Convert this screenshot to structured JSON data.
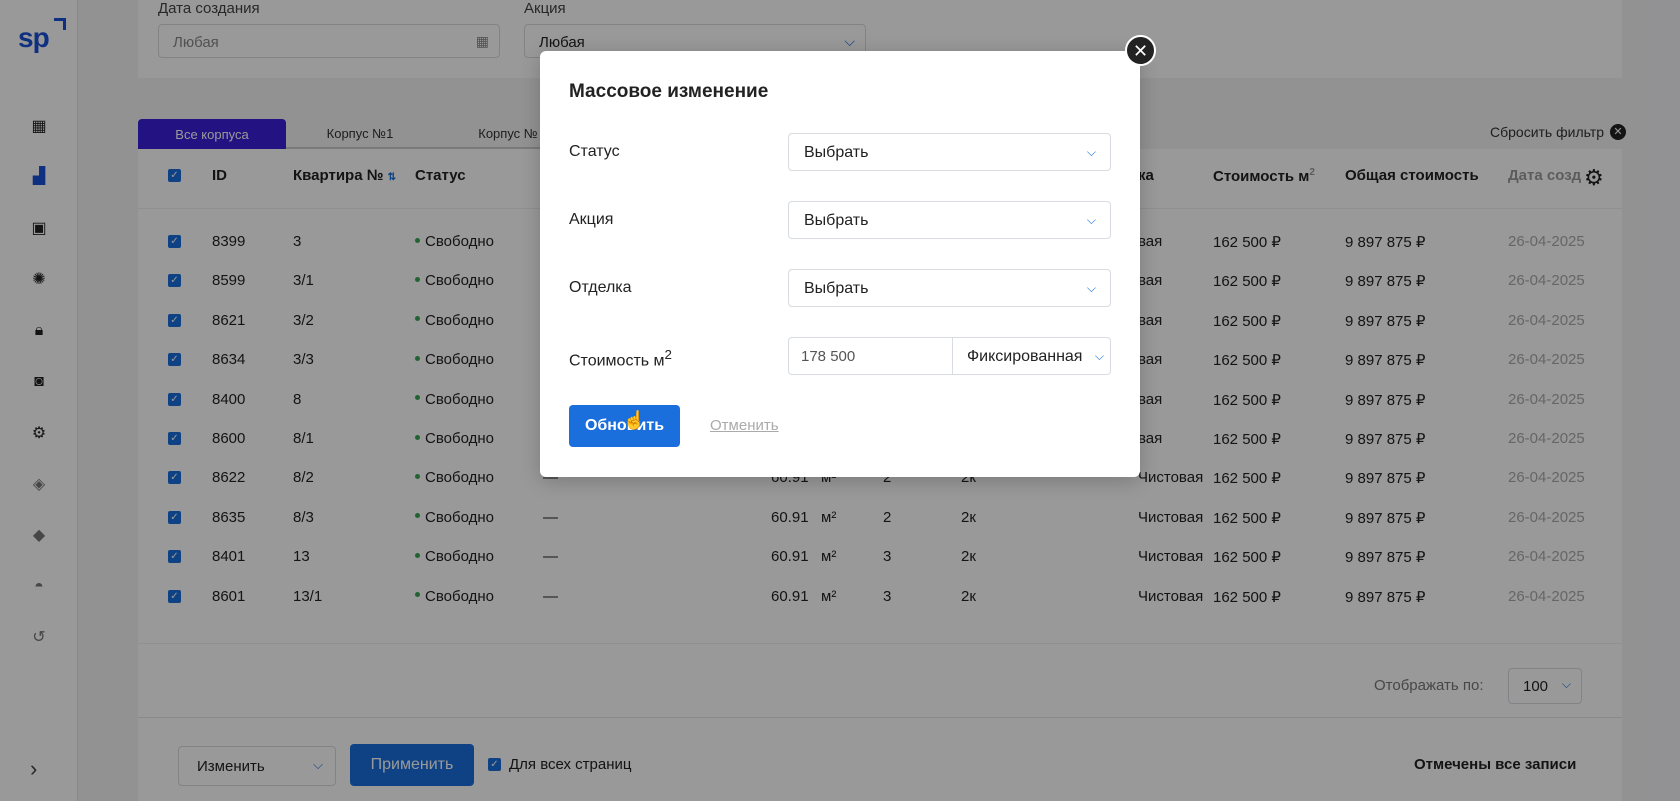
{
  "sidebar": {
    "logo": "sp",
    "icons": [
      "dashboard-icon",
      "buildings-icon",
      "floorplan-icon",
      "palette-icon",
      "lock-icon",
      "bag-icon",
      "settings-icon",
      "diamond-icon",
      "tag-icon",
      "helmet-icon",
      "history-icon"
    ],
    "expand_glyph": "›"
  },
  "filters": {
    "created_label": "Дата создания",
    "created_value": "Любая",
    "promo_label": "Акция",
    "promo_value": "Любая"
  },
  "tabs": [
    "Все корпуса",
    "Корпус №1",
    "Корпус №"
  ],
  "reset_filter": "Сбросить фильтр",
  "table": {
    "headers": {
      "id": "ID",
      "apt": "Квартира №",
      "status": "Статус",
      "finish": "ка",
      "price_m2": "Стоимость м",
      "total": "Общая стоимость",
      "date": "Дата созд"
    },
    "rows": [
      {
        "id": "8399",
        "apt": "3",
        "status": "Свободно",
        "dash": "",
        "area": "",
        "unit": "",
        "rooms": "",
        "type": "",
        "finish": "вая",
        "price": "162 500 ₽",
        "total": "9 897 875 ₽",
        "date": "26-04-2025"
      },
      {
        "id": "8599",
        "apt": "3/1",
        "status": "Свободно",
        "dash": "",
        "area": "",
        "unit": "",
        "rooms": "",
        "type": "",
        "finish": "вая",
        "price": "162 500 ₽",
        "total": "9 897 875 ₽",
        "date": "26-04-2025"
      },
      {
        "id": "8621",
        "apt": "3/2",
        "status": "Свободно",
        "dash": "",
        "area": "",
        "unit": "",
        "rooms": "",
        "type": "",
        "finish": "вая",
        "price": "162 500 ₽",
        "total": "9 897 875 ₽",
        "date": "26-04-2025"
      },
      {
        "id": "8634",
        "apt": "3/3",
        "status": "Свободно",
        "dash": "",
        "area": "",
        "unit": "",
        "rooms": "",
        "type": "",
        "finish": "вая",
        "price": "162 500 ₽",
        "total": "9 897 875 ₽",
        "date": "26-04-2025"
      },
      {
        "id": "8400",
        "apt": "8",
        "status": "Свободно",
        "dash": "",
        "area": "",
        "unit": "",
        "rooms": "",
        "type": "",
        "finish": "вая",
        "price": "162 500 ₽",
        "total": "9 897 875 ₽",
        "date": "26-04-2025"
      },
      {
        "id": "8600",
        "apt": "8/1",
        "status": "Свободно",
        "dash": "",
        "area": "",
        "unit": "",
        "rooms": "",
        "type": "",
        "finish": "вая",
        "price": "162 500 ₽",
        "total": "9 897 875 ₽",
        "date": "26-04-2025"
      },
      {
        "id": "8622",
        "apt": "8/2",
        "status": "Свободно",
        "dash": "—",
        "area": "60.91",
        "unit": "м²",
        "rooms": "2",
        "type": "2к",
        "finish": "Чистовая",
        "price": "162 500 ₽",
        "total": "9 897 875 ₽",
        "date": "26-04-2025"
      },
      {
        "id": "8635",
        "apt": "8/3",
        "status": "Свободно",
        "dash": "—",
        "area": "60.91",
        "unit": "м²",
        "rooms": "2",
        "type": "2к",
        "finish": "Чистовая",
        "price": "162 500 ₽",
        "total": "9 897 875 ₽",
        "date": "26-04-2025"
      },
      {
        "id": "8401",
        "apt": "13",
        "status": "Свободно",
        "dash": "—",
        "area": "60.91",
        "unit": "м²",
        "rooms": "3",
        "type": "2к",
        "finish": "Чистовая",
        "price": "162 500 ₽",
        "total": "9 897 875 ₽",
        "date": "26-04-2025"
      },
      {
        "id": "8601",
        "apt": "13/1",
        "status": "Свободно",
        "dash": "—",
        "area": "60.91",
        "unit": "м²",
        "rooms": "3",
        "type": "2к",
        "finish": "Чистовая",
        "price": "162 500 ₽",
        "total": "9 897 875 ₽",
        "date": "26-04-2025"
      }
    ]
  },
  "pager": {
    "label": "Отображать по:",
    "value": "100"
  },
  "bottom": {
    "action_select": "Изменить",
    "apply": "Применить",
    "all_pages": "Для всех страниц",
    "all_selected": "Отмечены все записи"
  },
  "modal": {
    "title": "Массовое изменение",
    "status_label": "Статус",
    "status_value": "Выбрать",
    "promo_label": "Акция",
    "promo_value": "Выбрать",
    "finish_label": "Отделка",
    "finish_value": "Выбрать",
    "price_label": "Стоимость м",
    "price_sup": "2",
    "price_value": "178 500",
    "price_type": "Фиксированная",
    "update": "Обновить",
    "cancel": "Отменить"
  },
  "colors": {
    "accent": "#1a6fdc",
    "tab_active": "#3b1fd8",
    "status_ok": "#3aa655"
  }
}
